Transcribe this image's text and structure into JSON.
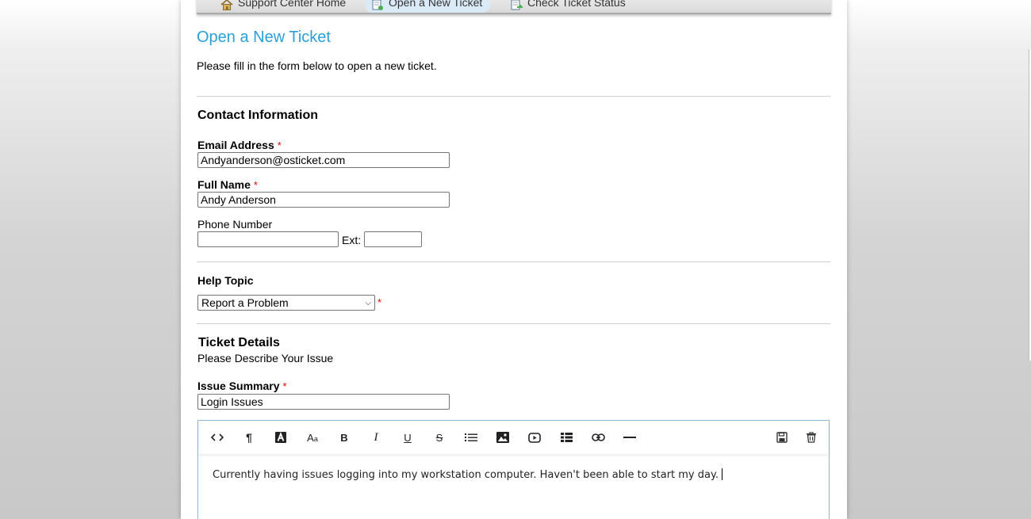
{
  "nav": {
    "items": [
      {
        "label": "Support Center Home",
        "icon": "home-icon"
      },
      {
        "label": "Open a New Ticket",
        "icon": "new-ticket-icon"
      },
      {
        "label": "Check Ticket Status",
        "icon": "ticket-status-icon"
      }
    ]
  },
  "page": {
    "title": "Open a New Ticket",
    "intro": "Please fill in the form below to open a new ticket."
  },
  "contact": {
    "heading": "Contact Information",
    "email_label": "Email Address",
    "email_value": "Andyanderson@osticket.com",
    "name_label": "Full Name",
    "name_value": "Andy Anderson",
    "phone_label": "Phone Number",
    "phone_value": "",
    "ext_label": "Ext:",
    "ext_value": "",
    "required_mark": "*"
  },
  "help_topic": {
    "heading": "Help Topic",
    "selected": "Report a Problem"
  },
  "details": {
    "heading": "Ticket Details",
    "subheading": "Please Describe Your Issue",
    "summary_label": "Issue Summary",
    "summary_value": "Login Issues",
    "body_text": "Currently having issues logging into my workstation computer. Haven't been able to start my day."
  },
  "toolbar": {
    "buttons": [
      "code-view",
      "paragraph",
      "text-color",
      "font-size",
      "bold",
      "italic",
      "underline",
      "strikethrough",
      "list",
      "image",
      "video",
      "table",
      "link",
      "horizontal-rule",
      "save",
      "delete"
    ]
  },
  "colors": {
    "accent": "#2a9fd8",
    "required": "#dd0000"
  }
}
